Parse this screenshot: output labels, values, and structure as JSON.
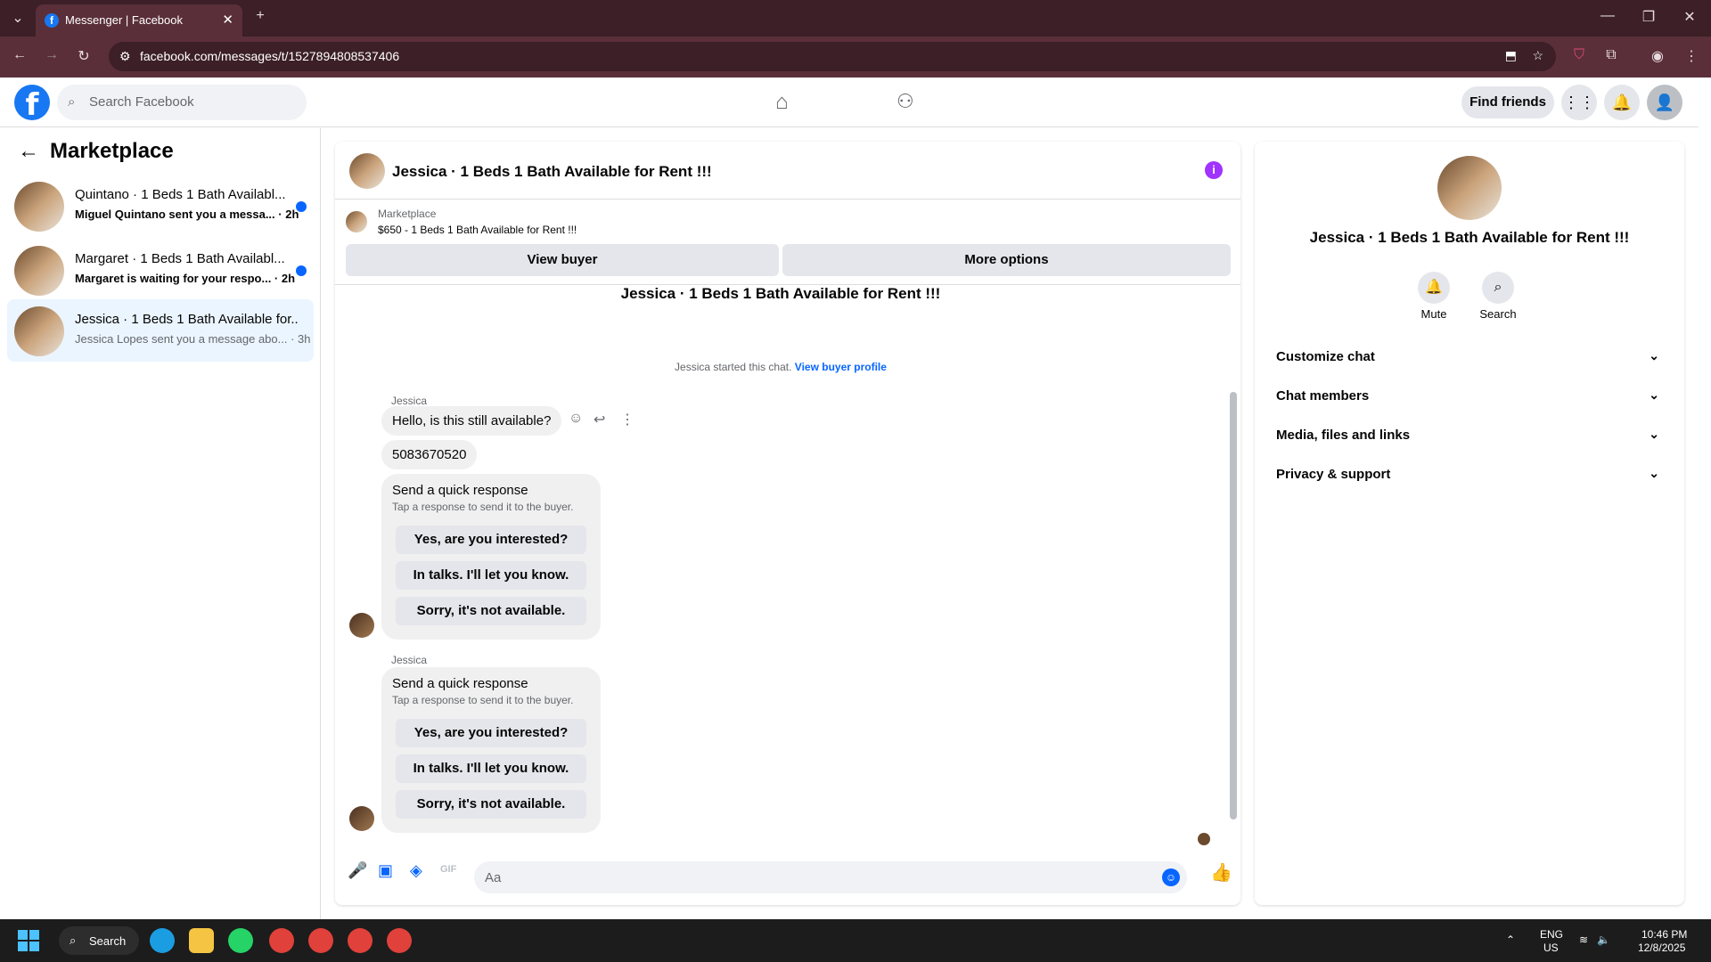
{
  "browser": {
    "tab_title": "Messenger | Facebook",
    "url": "facebook.com/messages/t/1527894808537406"
  },
  "fb": {
    "search_placeholder": "Search Facebook",
    "find_friends": "Find friends"
  },
  "left": {
    "title": "Marketplace",
    "conversations": [
      {
        "title": "Quintano · 1 Beds 1 Bath Availabl...",
        "snippet": "Miguel Quintano sent you a messa... · 2h",
        "unread": true
      },
      {
        "title": "Margaret · 1 Beds 1 Bath Availabl...",
        "snippet": "Margaret is waiting for your respo... · 2h",
        "unread": true
      },
      {
        "title": "Jessica · 1 Beds 1 Bath Available for...",
        "snippet": "Jessica Lopes sent you a message abo... · 3h",
        "unread": false
      }
    ]
  },
  "chat": {
    "title": "Jessica · 1 Beds 1 Bath Available for Rent !!!",
    "listing_source": "Marketplace",
    "listing_line": "$650 - 1 Beds 1 Bath Available for Rent !!!",
    "view_buyer": "View buyer",
    "more_options": "More options",
    "thread_title": "Jessica · 1 Beds 1 Bath Available for Rent !!!",
    "started_text": "Jessica started this chat.",
    "started_link": "View buyer profile",
    "sender_name": "Jessica",
    "message1": "Hello, is this still available?",
    "message2": "5083670520",
    "quick_response": {
      "heading": "Send a quick response",
      "subheading": "Tap a response to send it to the buyer.",
      "options": [
        "Yes, are you interested?",
        "In talks. I'll let you know.",
        "Sorry, it's not available."
      ]
    },
    "composer_placeholder": "Aa"
  },
  "right": {
    "title": "Jessica · 1 Beds 1 Bath Available for Rent !!!",
    "mute": "Mute",
    "search": "Search",
    "sections": [
      "Customize chat",
      "Chat members",
      "Media, files and links",
      "Privacy & support"
    ]
  },
  "taskbar": {
    "search": "Search",
    "lang1": "ENG",
    "lang2": "US",
    "time": "10:46 PM",
    "date": "12/8/2025"
  },
  "colors": {
    "accent": "#0866ff",
    "brand": "#1877f2",
    "chrome": "#3c1f27"
  }
}
